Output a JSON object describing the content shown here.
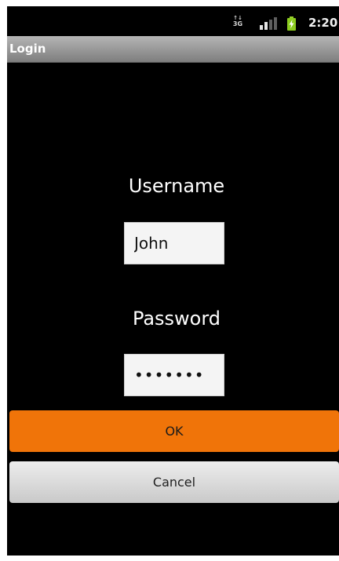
{
  "status_bar": {
    "network_type": "3G",
    "network_arrows": "↑↓",
    "signal_icon": "signal-bars-icon",
    "battery_icon": "battery-charging-icon",
    "time": "2:20"
  },
  "title_bar": {
    "title": "Login"
  },
  "form": {
    "username_label": "Username",
    "username_value": "John",
    "password_label": "Password",
    "password_value": "•••••••"
  },
  "buttons": {
    "ok_label": "OK",
    "cancel_label": "Cancel"
  },
  "colors": {
    "accent": "#f07409",
    "background": "#000000",
    "title_bar": "#9a9a9a"
  }
}
